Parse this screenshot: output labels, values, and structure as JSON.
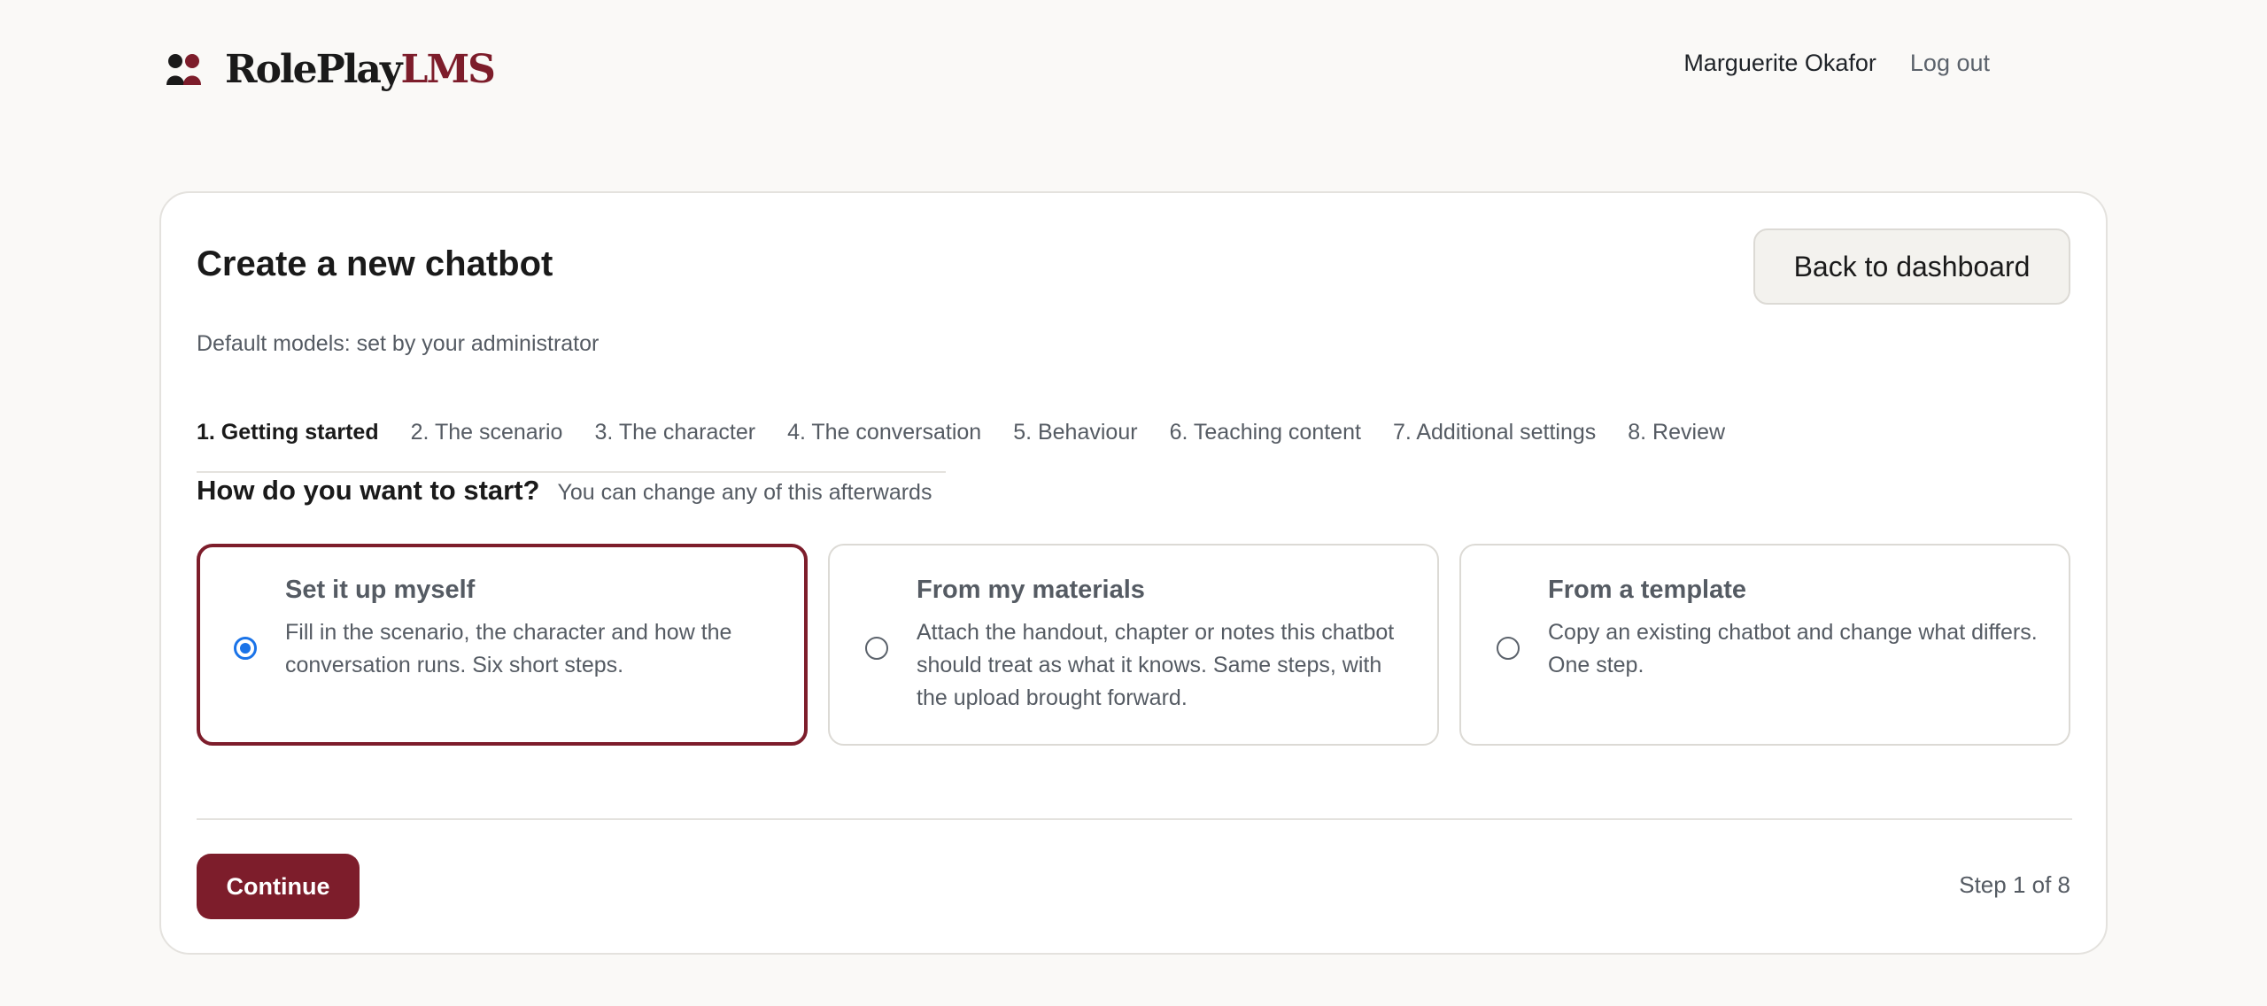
{
  "header": {
    "logo": {
      "part1": "RolePlay",
      "part2": "LMS"
    },
    "user_name": "Marguerite Okafor",
    "logout_label": "Log out"
  },
  "page": {
    "title": "Create a new chatbot",
    "back_label": "Back to dashboard",
    "subtitle": "Default models: set by your administrator"
  },
  "steps": [
    {
      "label": "1. Getting started",
      "active": true
    },
    {
      "label": "2. The scenario",
      "active": false
    },
    {
      "label": "3. The character",
      "active": false
    },
    {
      "label": "4. The conversation",
      "active": false
    },
    {
      "label": "5. Behaviour",
      "active": false
    },
    {
      "label": "6. Teaching content",
      "active": false
    },
    {
      "label": "7. Additional settings",
      "active": false
    },
    {
      "label": "8. Review",
      "active": false
    }
  ],
  "question": {
    "main": "How do you want to start?",
    "hint": "You can change any of this afterwards"
  },
  "options": [
    {
      "title": "Set it up myself",
      "description": "Fill in the scenario, the character and how the conversation runs. Six short steps.",
      "selected": true
    },
    {
      "title": "From my materials",
      "description": "Attach the handout, chapter or notes this chatbot should treat as what it knows. Same steps, with the upload brought forward.",
      "selected": false
    },
    {
      "title": "From a template",
      "description": "Copy an existing chatbot and change what differs. One step.",
      "selected": false
    }
  ],
  "footer": {
    "continue_label": "Continue",
    "step_count": "Step 1 of 8"
  },
  "colors": {
    "brand": "#7d1d2b",
    "radio_selected": "#1a73e8",
    "background": "#faf9f7"
  }
}
